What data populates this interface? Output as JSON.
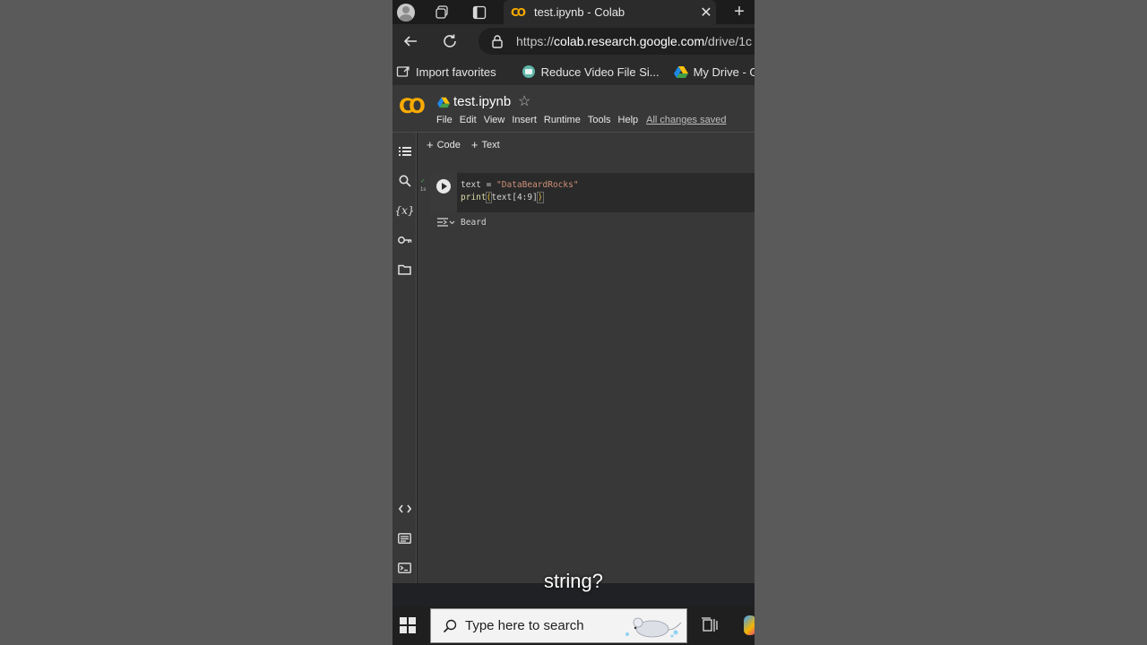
{
  "browser": {
    "tab_title": "test.ipynb - Colab",
    "url_prefix": "https://",
    "url_host": "colab.research.google.com",
    "url_path": "/drive/1c",
    "favorites": [
      {
        "label": "Import favorites",
        "icon": "import-favorites-icon"
      },
      {
        "label": "Reduce Video File Si...",
        "icon": "site-globe-icon"
      },
      {
        "label": "My Drive - Goog",
        "icon": "google-drive-icon"
      }
    ]
  },
  "colab": {
    "logo": "CO",
    "notebook_name": "test.ipynb",
    "menu": [
      "File",
      "Edit",
      "View",
      "Insert",
      "Runtime",
      "Tools",
      "Help"
    ],
    "save_status": "All changes saved",
    "toolbar": {
      "code_label": "Code",
      "text_label": "Text"
    },
    "cell": {
      "exec_mark": "✓",
      "exec_time": "1s",
      "line1_var": "text = ",
      "line1_str": "\"DataBeardRocks\"",
      "line2_fn": "print",
      "line2_open": "(",
      "line2_mid": "text[4:9]",
      "line2_close": ")",
      "output": "Beard"
    }
  },
  "caption": "string?",
  "taskbar": {
    "search_placeholder": "Type here to search"
  },
  "colors": {
    "colab_orange": "#f9ab00",
    "string": "#ce9178",
    "function": "#dcdcaa"
  }
}
